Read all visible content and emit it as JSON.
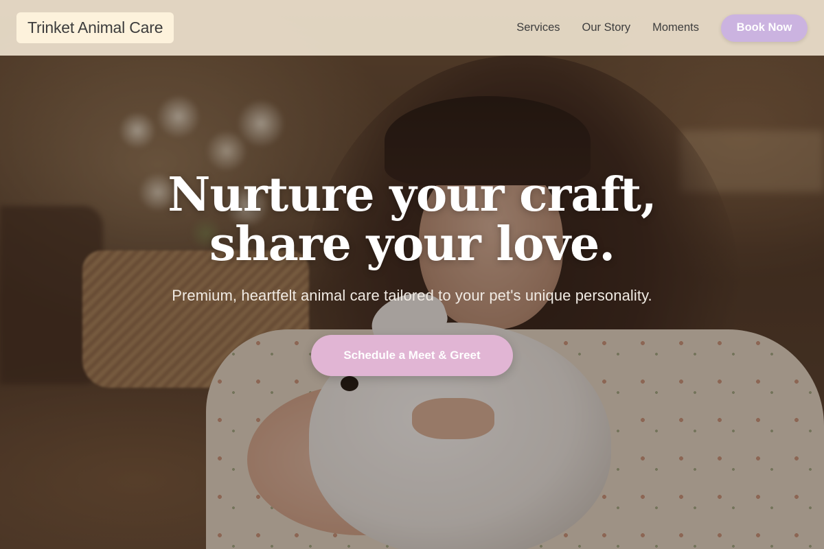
{
  "header": {
    "brand": "Trinket Animal Care",
    "nav": {
      "services": "Services",
      "our_story": "Our Story",
      "moments": "Moments"
    },
    "book_button": "Book Now"
  },
  "hero": {
    "headline": "Nurture your craft, share your love.",
    "subtitle": "Premium, heartfelt animal care tailored to your pet's unique personality.",
    "cta": "Schedule a Meet & Greet"
  },
  "colors": {
    "header_bg": "#ece0cc",
    "brand_bg": "#fdf2dc",
    "book_button": "#cbb3e0",
    "cta_button": "#e1b5d4",
    "headline_text": "#ffffff"
  },
  "icons": {
    "hero_image": "woman-holding-rabbit-photo"
  }
}
